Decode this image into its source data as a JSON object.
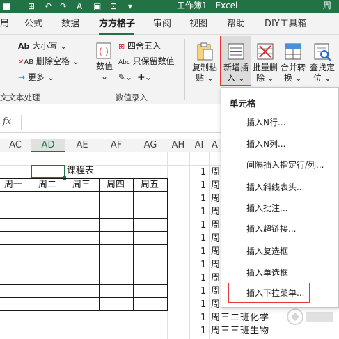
{
  "titlebar": {
    "title": "工作簿1 - Excel",
    "user": "周"
  },
  "tabs": [
    "局",
    "公式",
    "数据",
    "方方格子",
    "审阅",
    "视图",
    "帮助",
    "DIY工具箱"
  ],
  "active_tab": "方方格子",
  "ribbon": {
    "text_group": {
      "items": [
        "大小写",
        "删除空格",
        "更多"
      ],
      "label": "文本处理"
    },
    "value_group": {
      "value_button": "数值",
      "items": [
        "四舍五入",
        "只保留数值"
      ],
      "label": "数值录入"
    },
    "big_buttons": [
      {
        "line1": "复制粘",
        "line2": "贴"
      },
      {
        "line1": "新增插",
        "line2": "入"
      },
      {
        "line1": "批量删",
        "line2": "除"
      },
      {
        "line1": "合并转",
        "line2": "换"
      },
      {
        "line1": "查找定",
        "line2": "位"
      }
    ]
  },
  "formula_bar": {
    "fx": "fx",
    "value": ""
  },
  "columns": [
    "AC",
    "AD",
    "AE",
    "AF",
    "AG",
    "AH",
    "AI",
    "A"
  ],
  "selected_column": "AD",
  "sheet": {
    "title_cell": "课程表",
    "days": [
      "周一",
      "周二",
      "周三",
      "周四",
      "周五"
    ],
    "right_col_numbers": [
      "1",
      "1",
      "1",
      "1",
      "1",
      "1",
      "1",
      "1",
      "1",
      "1",
      "1"
    ],
    "right_col_labels": [
      "周",
      "周",
      "周",
      "周",
      "周",
      "周",
      "周",
      "周",
      "周",
      "周",
      "周"
    ],
    "bottom_rows": [
      {
        "label": "周三二班化学"
      },
      {
        "label": "周三三班生物"
      }
    ],
    "partial_row": "周三一班化学"
  },
  "dropdown": {
    "section": "单元格",
    "items": [
      "插入N行...",
      "插入N列...",
      "间隔插入指定行/列...",
      "插入斜线表头...",
      "插入批注...",
      "插入超链接...",
      "插入复选框",
      "插入单选框",
      "插入下拉菜单..."
    ],
    "highlighted": "插入下拉菜单..."
  },
  "colors": {
    "excel_green": "#217346",
    "highlight_red": "#e53935"
  }
}
